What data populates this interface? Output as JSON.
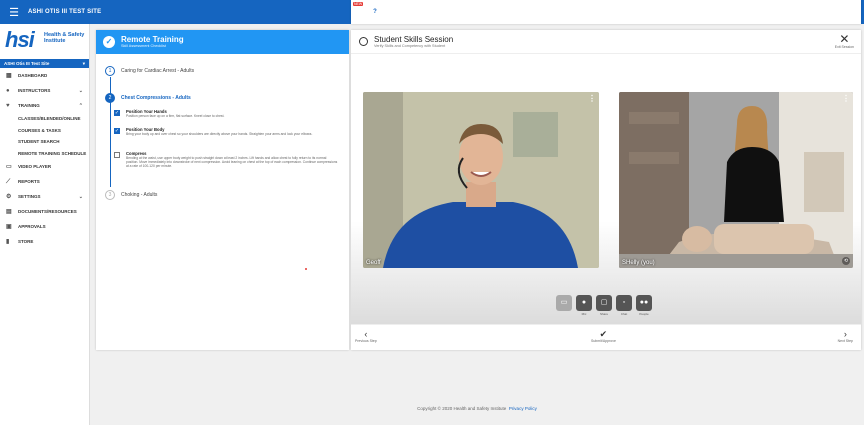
{
  "topbar": {
    "site_title": "ASHI OTIS III TEST SITE",
    "badge": "NEW",
    "help": "?"
  },
  "sidebar": {
    "logo_text": "hsi",
    "logo_sub": "Health & Safety Institute",
    "org": "ASHI Otis III Test Site",
    "items": [
      {
        "label": "Dashboard",
        "icon": "dashboard-icon"
      },
      {
        "label": "Instructors",
        "icon": "instructors-icon"
      },
      {
        "label": "Training",
        "icon": "training-icon"
      },
      {
        "label": "Classes/Blended/Online"
      },
      {
        "label": "Courses & Tasks"
      },
      {
        "label": "Student Search"
      },
      {
        "label": "Remote Training Schedule"
      },
      {
        "label": "Video Player",
        "icon": "video-icon"
      },
      {
        "label": "Reports",
        "icon": "reports-icon"
      },
      {
        "label": "Settings",
        "icon": "settings-icon"
      },
      {
        "label": "Documents/Resources",
        "icon": "documents-icon"
      },
      {
        "label": "Approvals",
        "icon": "approvals-icon"
      },
      {
        "label": "Store",
        "icon": "store-icon"
      }
    ]
  },
  "checklist": {
    "title": "Remote Training",
    "subtitle": "Skill Assessment Checklist",
    "steps": [
      {
        "num": "1",
        "label": "Caring for Cardiac Arrest - Adults"
      },
      {
        "num": "2",
        "label": "Chest Compressions - Adults"
      },
      {
        "num": "3",
        "label": "Choking - Adults"
      }
    ],
    "items": [
      {
        "title": "Position Your Hands",
        "desc": "Position person face up on a firm, flat surface. Kneel close to chest.",
        "checked": true
      },
      {
        "title": "Position Your Body",
        "desc": "Bring your body up and over chest so your shoulders are directly above your hands. Straighten your arms and lock your elbows.",
        "checked": true
      },
      {
        "title": "Compress",
        "desc": "Bending at the waist, use upper body weight to push straight down at least 2 inches. Lift hands and allow chest to fully return to its normal position. Move immediately into downstroke of next compression. Avoid leaning on chest at the top of each compression. Continue compressions at a rate of 100-120 per minute.",
        "checked": false
      }
    ]
  },
  "session": {
    "title": "Student Skills Session",
    "subtitle": "Verify Skills and Competency with Student",
    "exit_label": "Exit Session",
    "participants": [
      {
        "name": "Geoff"
      },
      {
        "name": "SHelly (you)"
      }
    ],
    "controls": [
      {
        "label": "",
        "icon": "camera-icon"
      },
      {
        "label": "Mic",
        "icon": "mic-icon"
      },
      {
        "label": "Share",
        "icon": "screen-share-icon"
      },
      {
        "label": "Chat",
        "icon": "chat-icon"
      },
      {
        "label": "People",
        "icon": "people-icon"
      }
    ],
    "prev_label": "Previous Step",
    "submit_label": "Submit/Approve",
    "next_label": "Next Step"
  },
  "footer": {
    "copyright": "Copyright © 2020 Health and Safety Institute",
    "privacy": "Privacy Policy"
  },
  "colors": {
    "brand": "#1565c0",
    "accent": "#2196f3"
  }
}
